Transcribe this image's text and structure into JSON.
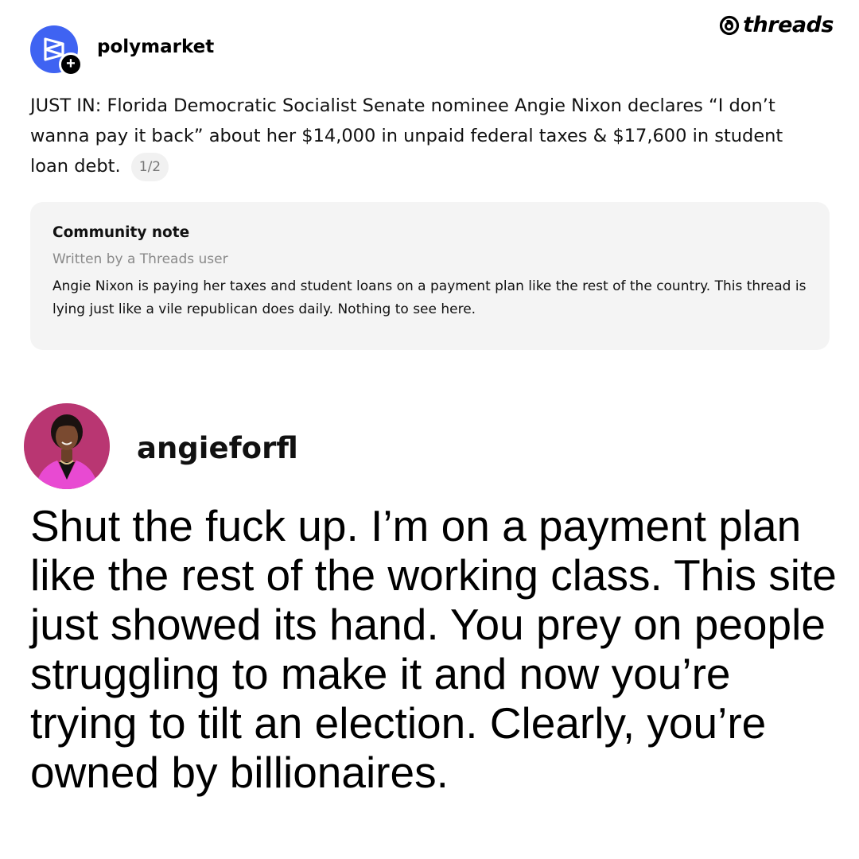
{
  "brand": {
    "name": "threads",
    "icon": "threads-logo-icon"
  },
  "post1": {
    "avatar_icon": "polymarket-logo-icon",
    "follow_icon": "plus-icon",
    "username": "polymarket",
    "body": "JUST IN: Florida Democratic Socialist Senate nominee Angie Nixon declares “I don’t wanna pay it back” about her $14,000 in unpaid federal taxes & $17,600 in student loan debt.",
    "page_indicator": "1/2",
    "community_note": {
      "title": "Community note",
      "meta": "Written by a Threads user",
      "text": "Angie Nixon is paying her taxes and student loans on a payment plan like the rest of the country. This thread is lying just like a vile republican does daily. Nothing to see here."
    }
  },
  "post2": {
    "avatar": "profile-photo",
    "username": "angieforfl",
    "body": "Shut the fuck up. I’m on a payment plan like the rest of the working class. This site just showed its hand. You prey on people struggling to make it and now you’re trying to tilt an election. Clearly, you’re owned by billionaires."
  },
  "colors": {
    "background": "#ffffff",
    "polymarket_blue": "#3f63f2",
    "note_background": "#f4f4f4",
    "muted_text": "#8a8a8a",
    "avatar2_background": "#b0306a",
    "avatar2_jacket": "#e84ad2"
  }
}
